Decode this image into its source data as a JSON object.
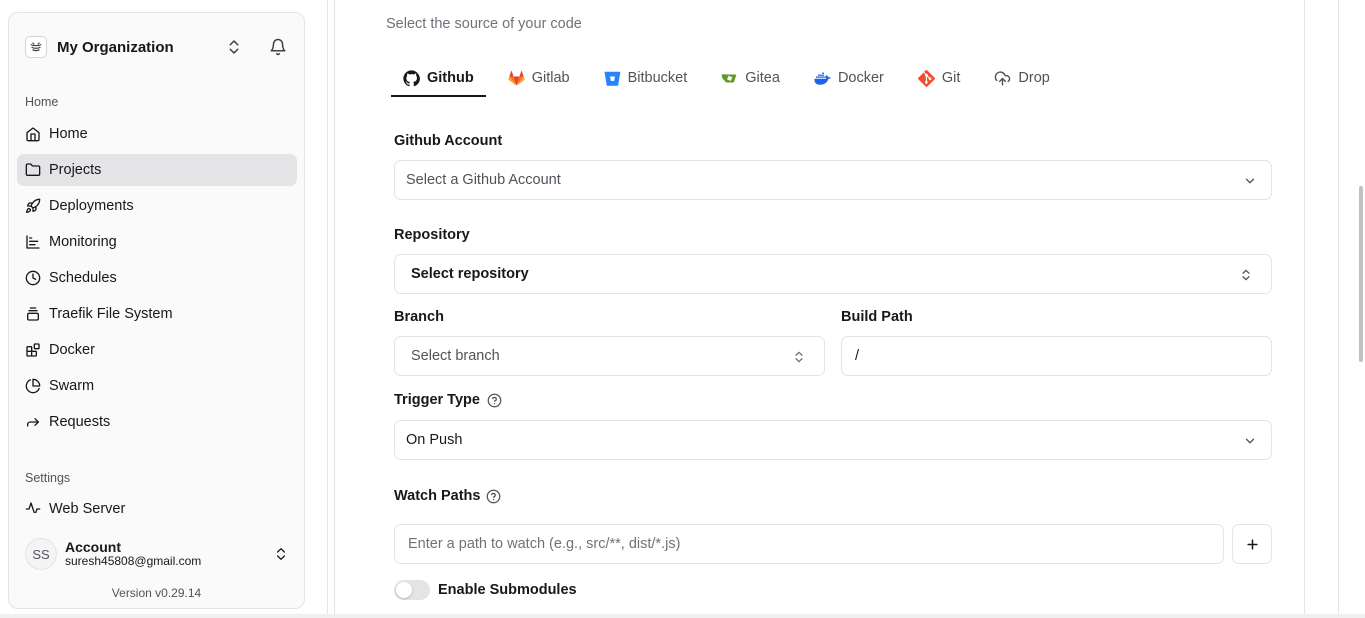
{
  "sidebar": {
    "org_name": "My Organization",
    "groups": {
      "home": "Home",
      "settings": "Settings"
    },
    "items": [
      {
        "label": "Home",
        "icon": "home-icon"
      },
      {
        "label": "Projects",
        "icon": "folder-icon",
        "active": true
      },
      {
        "label": "Deployments",
        "icon": "rocket-icon"
      },
      {
        "label": "Monitoring",
        "icon": "chart-icon"
      },
      {
        "label": "Schedules",
        "icon": "clock-icon"
      },
      {
        "label": "Traefik File System",
        "icon": "file-stack-icon"
      },
      {
        "label": "Docker",
        "icon": "blocks-icon"
      },
      {
        "label": "Swarm",
        "icon": "pie-chart-icon"
      },
      {
        "label": "Requests",
        "icon": "forward-arrow-icon"
      }
    ],
    "settings_items": [
      {
        "label": "Web Server",
        "icon": "activity-icon"
      }
    ],
    "account": {
      "initials": "SS",
      "name": "Account",
      "email": "suresh45808@gmail.com"
    },
    "version": "Version v0.29.14"
  },
  "main": {
    "subtitle": "Select the source of your code",
    "tabs": [
      {
        "label": "Github",
        "icon": "github-icon",
        "active": true
      },
      {
        "label": "Gitlab",
        "icon": "gitlab-icon"
      },
      {
        "label": "Bitbucket",
        "icon": "bitbucket-icon"
      },
      {
        "label": "Gitea",
        "icon": "gitea-icon"
      },
      {
        "label": "Docker",
        "icon": "docker-icon"
      },
      {
        "label": "Git",
        "icon": "git-icon"
      },
      {
        "label": "Drop",
        "icon": "upload-cloud-icon"
      }
    ],
    "form": {
      "github_account_label": "Github Account",
      "github_account_placeholder": "Select a Github Account",
      "repository_label": "Repository",
      "repository_value": "Select repository",
      "branch_label": "Branch",
      "branch_placeholder": "Select branch",
      "build_path_label": "Build Path",
      "build_path_value": "/",
      "trigger_type_label": "Trigger Type",
      "trigger_type_value": "On Push",
      "watch_paths_label": "Watch Paths",
      "watch_paths_placeholder": "Enter a path to watch (e.g., src/**, dist/*.js)",
      "submodules_label": "Enable Submodules",
      "submodules_enabled": false
    }
  },
  "colors": {
    "gitlab": "#e24329",
    "bitbucket": "#2684ff",
    "gitea": "#609926",
    "docker": "#1d63ed",
    "git": "#f05032",
    "active_nav": "#e4e4e7"
  }
}
